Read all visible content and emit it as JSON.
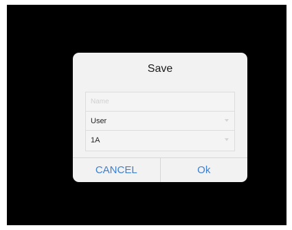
{
  "dialog": {
    "title": "Save",
    "name_field": {
      "placeholder": "Name",
      "value": ""
    },
    "user_select": {
      "selected": "User",
      "icon": "chevron-down-icon"
    },
    "group_select": {
      "selected": "1A",
      "icon": "chevron-down-icon"
    },
    "cancel_label": "CANCEL",
    "ok_label": "Ok"
  },
  "colors": {
    "backdrop": "#000000",
    "dialog_background": "#f2f2f2",
    "button_text": "#3b7fd0"
  }
}
